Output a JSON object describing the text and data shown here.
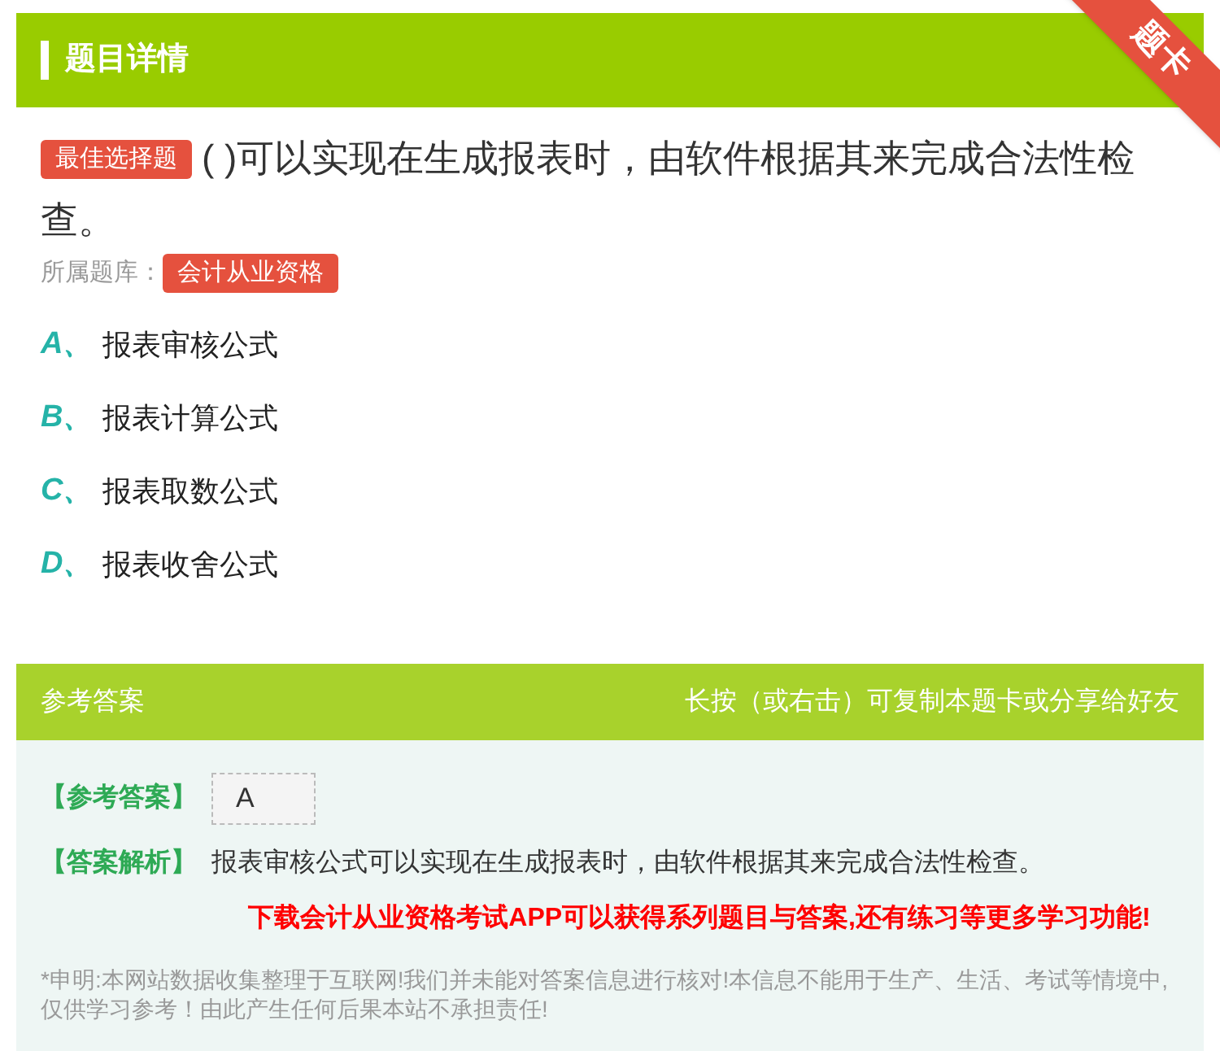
{
  "header": {
    "title": "题目详情",
    "ribbon": "题卡"
  },
  "question": {
    "tag": "最佳选择题",
    "text": "( )可以实现在生成报表时，由软件根据其来完成合法性检查。",
    "bank_label": "所属题库：",
    "bank": "会计从业资格"
  },
  "options": [
    {
      "letter": "A、",
      "text": "报表审核公式"
    },
    {
      "letter": "B、",
      "text": "报表计算公式"
    },
    {
      "letter": "C、",
      "text": "报表取数公式"
    },
    {
      "letter": "D、",
      "text": "报表收舍公式"
    }
  ],
  "answer": {
    "title": "参考答案",
    "hint": "长按（或右击）可复制本题卡或分享给好友",
    "answer_label": "【参考答案】",
    "answer_value": "A",
    "analysis_label": "【答案解析】",
    "analysis": "报表审核公式可以实现在生成报表时，由软件根据其来完成合法性检查。",
    "promo": "下载会计从业资格考试APP可以获得系列题目与答案,还有练习等更多学习功能!",
    "disclaimer": "*申明:本网站数据收集整理于互联网!我们并未能对答案信息进行核对!本信息不能用于生产、生活、考试等情境中,仅供学习参考！由此产生任何后果本站不承担责任!"
  }
}
